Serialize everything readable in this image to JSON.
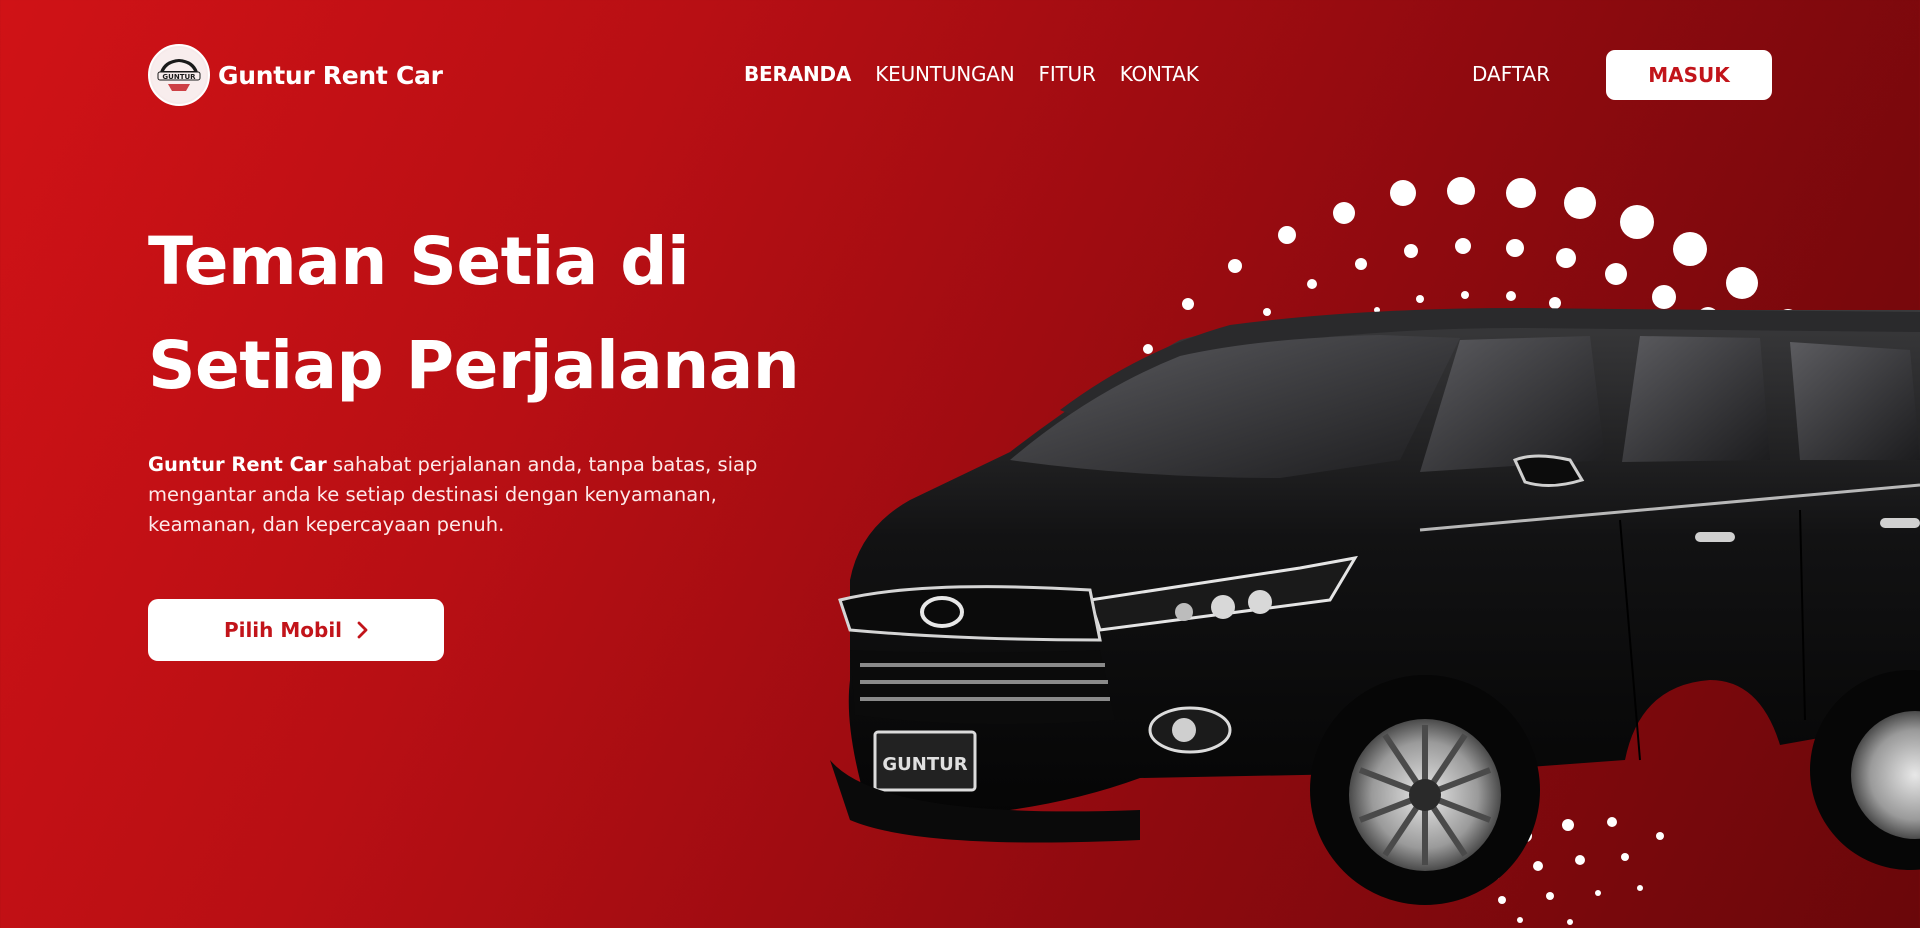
{
  "brand": {
    "name": "Guntur Rent Car",
    "badge_text": "GUNTUR"
  },
  "nav": {
    "items": [
      {
        "label": "BERANDA",
        "active": true
      },
      {
        "label": "KEUNTUNGAN",
        "active": false
      },
      {
        "label": "FITUR",
        "active": false
      },
      {
        "label": "KONTAK",
        "active": false
      }
    ],
    "register_label": "DAFTAR",
    "login_label": "MASUK"
  },
  "hero": {
    "title_line1": "Teman Setia di",
    "title_line2": "Setiap Perjalanan",
    "desc_brand": "Guntur Rent Car",
    "desc_rest": " sahabat perjalanan anda, tanpa batas, siap mengantar anda ke setiap destinasi dengan kenyamanan, keamanan, dan kepercayaan penuh.",
    "cta_label": "Pilih Mobil",
    "cta_icon": "chevron-right-icon",
    "plate_text": "GUNTUR"
  },
  "colors": {
    "accent": "#c2141a",
    "bg_start": "#d01216",
    "bg_end": "#6a070a",
    "white": "#ffffff"
  }
}
